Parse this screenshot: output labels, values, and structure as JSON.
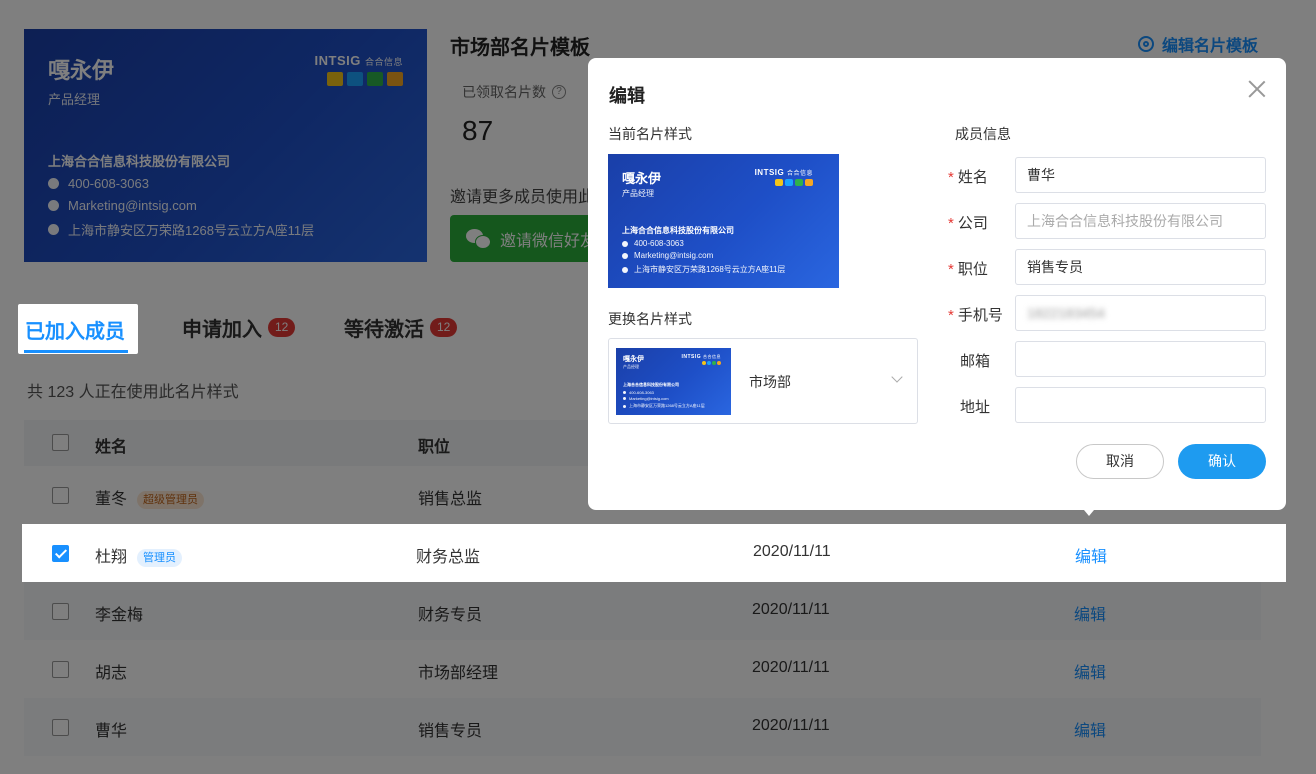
{
  "card": {
    "name": "嘎永伊",
    "title": "产品经理",
    "company": "上海合合信息科技股份有限公司",
    "phone": "400-608-3063",
    "email": "Marketing@intsig.com",
    "address": "上海市静安区万荣路1268号云立方A座11层",
    "brand": "INTSIG",
    "brand_sub": "合合信息",
    "app_colors": [
      "#f5c518",
      "#1aa3ff",
      "#2fb24a",
      "#f5a623"
    ]
  },
  "template": {
    "title": "市场部名片模板",
    "edit_label": "编辑名片模板",
    "claimed_label": "已领取名片数",
    "claimed_count": "87",
    "invite_text": "邀请更多成员使用此",
    "wechat_btn": "邀请微信好友"
  },
  "tabs": [
    {
      "label": "已加入成员"
    },
    {
      "label": "申请加入",
      "badge": "12"
    },
    {
      "label": "等待激活",
      "badge": "12"
    }
  ],
  "usage_text": "共 123 人正在使用此名片样式",
  "table": {
    "headers": {
      "name": "姓名",
      "position": "职位"
    },
    "rows": [
      {
        "name": "董冬",
        "role": "超级管理员",
        "position": "销售总监",
        "date": "",
        "action": ""
      },
      {
        "name": "杜翔",
        "role": "管理员",
        "position": "财务总监",
        "date": "2020/11/11",
        "action": "编辑"
      },
      {
        "name": "李金梅",
        "role": "",
        "position": "财务专员",
        "date": "2020/11/11",
        "action": "编辑"
      },
      {
        "name": "胡志",
        "role": "",
        "position": "市场部经理",
        "date": "2020/11/11",
        "action": "编辑"
      },
      {
        "name": "曹华",
        "role": "",
        "position": "销售专员",
        "date": "2020/11/11",
        "action": "编辑"
      }
    ]
  },
  "modal": {
    "title": "编辑",
    "current_style_label": "当前名片样式",
    "change_style_label": "更换名片样式",
    "style_option": "市场部",
    "member_info_label": "成员信息",
    "fields": {
      "name": {
        "label": "姓名",
        "value": "曹华"
      },
      "company": {
        "label": "公司",
        "placeholder": "上海合合信息科技股份有限公司"
      },
      "position": {
        "label": "职位",
        "value": "销售专员"
      },
      "phone": {
        "label": "手机号",
        "value": "1822183454"
      },
      "email": {
        "label": "邮箱",
        "value": ""
      },
      "address": {
        "label": "地址",
        "value": ""
      }
    },
    "required_mark": "*",
    "cancel": "取消",
    "confirm": "确认"
  }
}
